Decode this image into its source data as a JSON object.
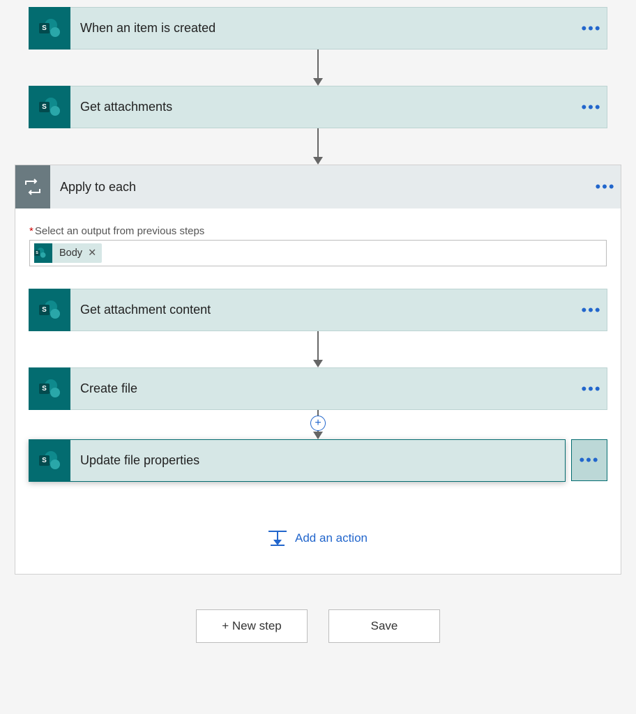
{
  "colors": {
    "accent_teal": "#036c70",
    "link_blue": "#2266cc",
    "header_gray": "#6a7a80"
  },
  "steps": {
    "trigger": {
      "title": "When an item is created",
      "icon": "sharepoint-icon"
    },
    "get_attachments": {
      "title": "Get attachments",
      "icon": "sharepoint-icon"
    }
  },
  "loop": {
    "title": "Apply to each",
    "field_label": "Select an output from previous steps",
    "token": {
      "label": "Body",
      "icon": "sharepoint-icon"
    },
    "inner_steps": {
      "get_content": {
        "title": "Get attachment content",
        "icon": "sharepoint-icon"
      },
      "create_file": {
        "title": "Create file",
        "icon": "sharepoint-icon"
      },
      "update_props": {
        "title": "Update file properties",
        "icon": "sharepoint-icon",
        "selected": true
      }
    },
    "add_action_label": "Add an action"
  },
  "footer": {
    "new_step_label": "+ New step",
    "save_label": "Save"
  }
}
